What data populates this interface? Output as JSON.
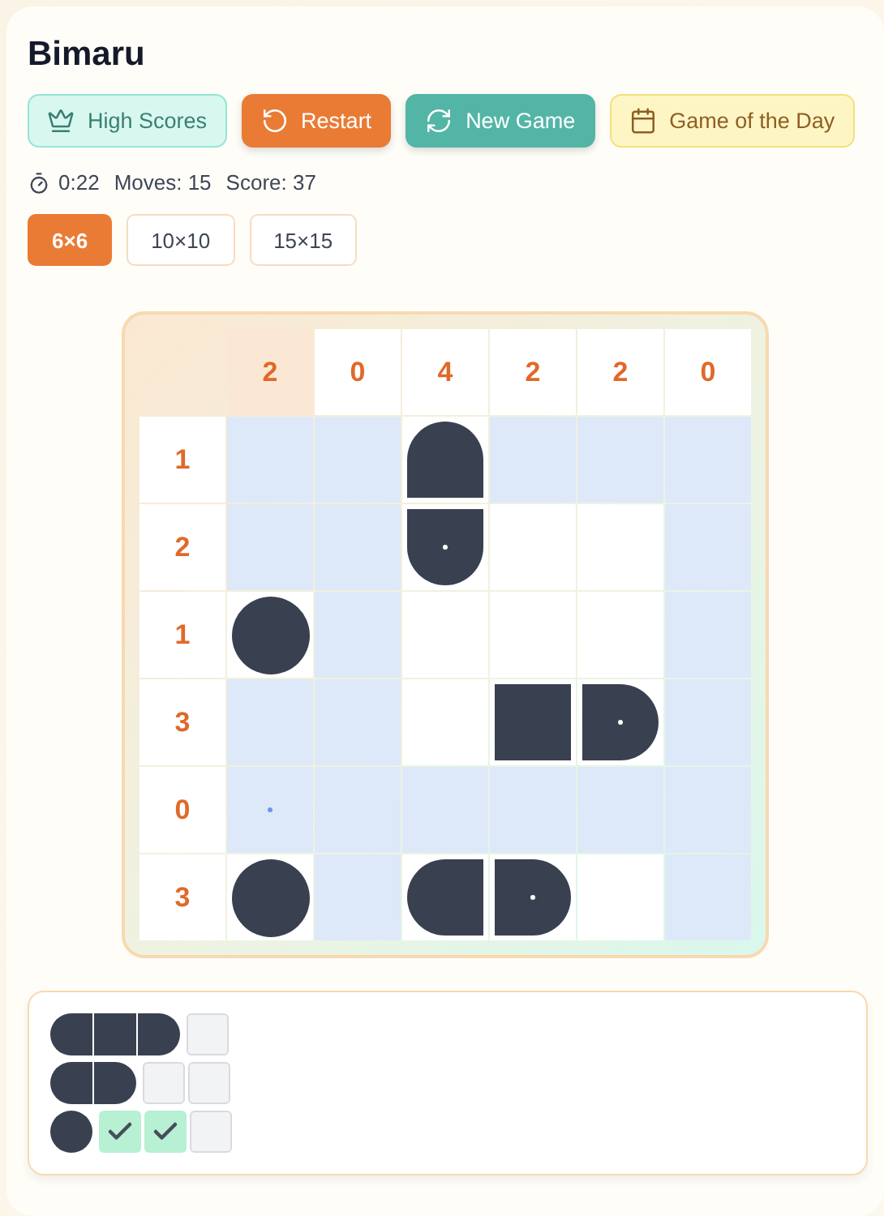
{
  "title": "Bimaru",
  "actions": [
    {
      "kind": "scores",
      "label": "High Scores"
    },
    {
      "kind": "restart",
      "label": "Restart"
    },
    {
      "kind": "new",
      "label": "New Game"
    },
    {
      "kind": "daily",
      "label": "Game of the Day"
    }
  ],
  "stats": {
    "time": "0:22",
    "moves": "Moves: 15",
    "score": "Score: 37"
  },
  "sizes": [
    {
      "label": "6×6",
      "selected": true
    },
    {
      "label": "10×10",
      "selected": false
    },
    {
      "label": "15×15",
      "selected": false
    }
  ],
  "board": {
    "column_counts": [
      {
        "label": "2",
        "highlighted": true
      },
      {
        "label": "0",
        "highlighted": false
      },
      {
        "label": "4",
        "highlighted": false
      },
      {
        "label": "2",
        "highlighted": false
      },
      {
        "label": "2",
        "highlighted": false
      },
      {
        "label": "0",
        "highlighted": false
      }
    ],
    "rows": [
      {
        "count": "1",
        "cells": [
          {
            "kind": "water",
            "marked": false
          },
          {
            "kind": "water",
            "marked": false
          },
          {
            "kind": "top",
            "marked": false
          },
          {
            "kind": "water",
            "marked": false
          },
          {
            "kind": "water",
            "marked": false
          },
          {
            "kind": "water",
            "marked": false
          }
        ]
      },
      {
        "count": "2",
        "cells": [
          {
            "kind": "water",
            "marked": false
          },
          {
            "kind": "water",
            "marked": false
          },
          {
            "kind": "bottom",
            "marked": true
          },
          {
            "kind": "empty",
            "marked": false
          },
          {
            "kind": "empty",
            "marked": false
          },
          {
            "kind": "water",
            "marked": false
          }
        ]
      },
      {
        "count": "1",
        "cells": [
          {
            "kind": "single",
            "marked": false
          },
          {
            "kind": "water",
            "marked": false
          },
          {
            "kind": "empty",
            "marked": false
          },
          {
            "kind": "empty",
            "marked": false
          },
          {
            "kind": "empty",
            "marked": false
          },
          {
            "kind": "water",
            "marked": false
          }
        ]
      },
      {
        "count": "3",
        "cells": [
          {
            "kind": "water",
            "marked": false
          },
          {
            "kind": "water",
            "marked": false
          },
          {
            "kind": "empty",
            "marked": false
          },
          {
            "kind": "middle",
            "marked": false
          },
          {
            "kind": "right",
            "marked": true
          },
          {
            "kind": "water",
            "marked": false
          }
        ]
      },
      {
        "count": "0",
        "cells": [
          {
            "kind": "water",
            "marked": true
          },
          {
            "kind": "water",
            "marked": false
          },
          {
            "kind": "water",
            "marked": false
          },
          {
            "kind": "water",
            "marked": false
          },
          {
            "kind": "water",
            "marked": false
          },
          {
            "kind": "water",
            "marked": false
          }
        ]
      },
      {
        "count": "3",
        "cells": [
          {
            "kind": "single",
            "marked": false
          },
          {
            "kind": "water",
            "marked": false
          },
          {
            "kind": "left",
            "marked": false
          },
          {
            "kind": "right",
            "marked": true
          },
          {
            "kind": "empty",
            "marked": false
          },
          {
            "kind": "water",
            "marked": false
          }
        ]
      }
    ]
  },
  "fleet": [
    {
      "ship": [
        {
          "kind": "left"
        },
        {
          "kind": "middle"
        },
        {
          "kind": "right"
        }
      ],
      "slots": [
        {
          "checked": false
        }
      ]
    },
    {
      "ship": [
        {
          "kind": "left"
        },
        {
          "kind": "right"
        }
      ],
      "slots": [
        {
          "checked": false
        },
        {
          "checked": false
        }
      ]
    },
    {
      "ship": [
        {
          "kind": "single"
        }
      ],
      "slots": [
        {
          "checked": true
        },
        {
          "checked": true
        },
        {
          "checked": false
        }
      ]
    }
  ]
}
